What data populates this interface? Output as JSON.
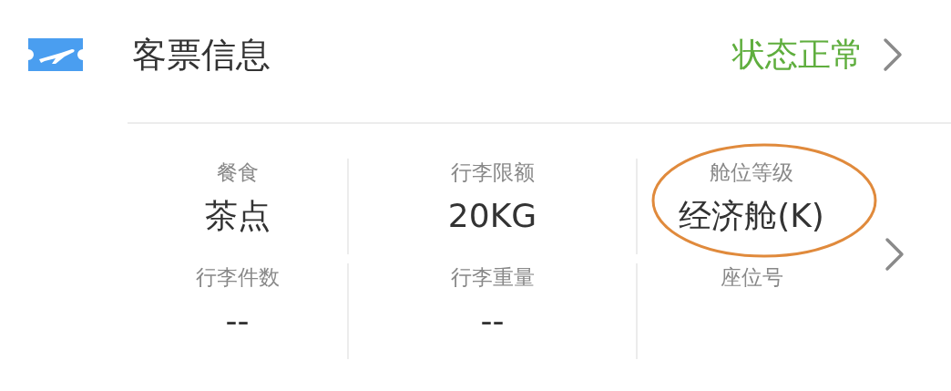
{
  "header": {
    "title": "客票信息",
    "status": "状态正常"
  },
  "fields": [
    {
      "label": "餐食",
      "value": "茶点",
      "annotated": false
    },
    {
      "label": "行李限额",
      "value": "20KG",
      "annotated": false
    },
    {
      "label": "舱位等级",
      "value": "经济舱(K)",
      "annotated": true
    },
    {
      "label": "行李件数",
      "value": "--",
      "annotated": false
    },
    {
      "label": "行李重量",
      "value": "--",
      "annotated": false
    },
    {
      "label": "座位号",
      "annotated": false
    }
  ]
}
